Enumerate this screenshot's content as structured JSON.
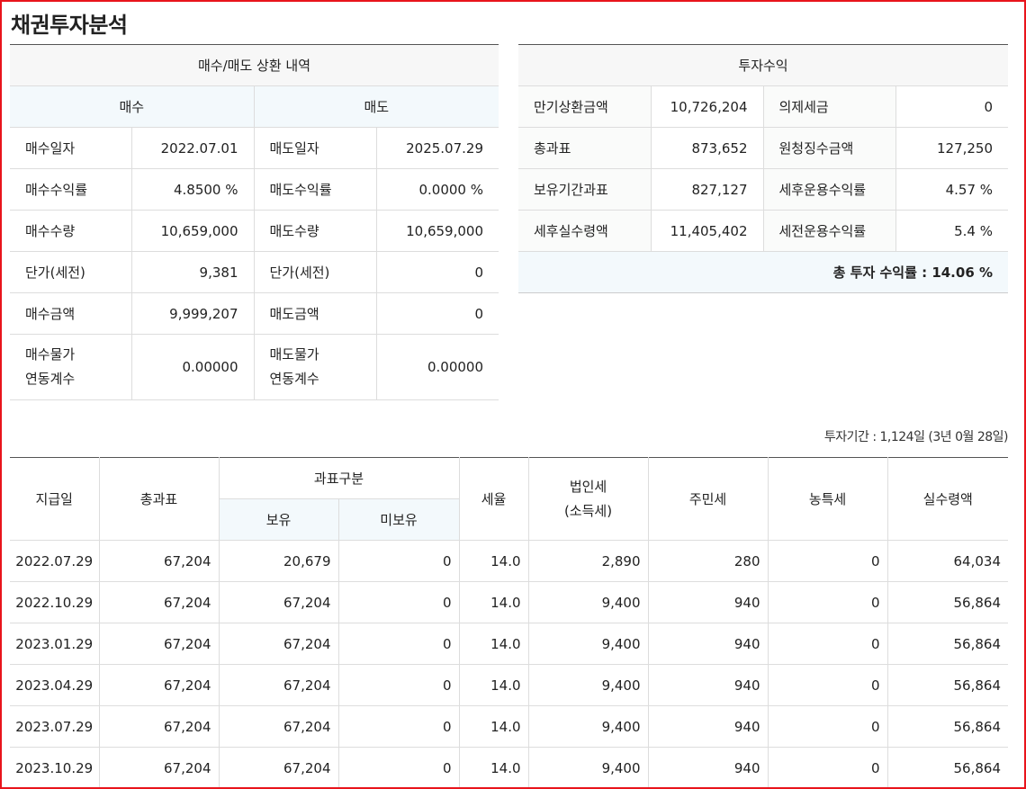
{
  "page_title": "채권투자분석",
  "trade": {
    "title": "매수/매도 상환 내역",
    "buy_header": "매수",
    "sell_header": "매도",
    "rows": [
      {
        "buy_label": "매수일자",
        "buy_value": "2022.07.01",
        "sell_label": "매도일자",
        "sell_value": "2025.07.29"
      },
      {
        "buy_label": "매수수익률",
        "buy_value": "4.8500 %",
        "sell_label": "매도수익률",
        "sell_value": "0.0000 %"
      },
      {
        "buy_label": "매수수량",
        "buy_value": "10,659,000",
        "sell_label": "매도수량",
        "sell_value": "10,659,000"
      },
      {
        "buy_label": "단가(세전)",
        "buy_value": "9,381",
        "sell_label": "단가(세전)",
        "sell_value": "0"
      },
      {
        "buy_label": "매수금액",
        "buy_value": "9,999,207",
        "sell_label": "매도금액",
        "sell_value": "0"
      }
    ],
    "index_row": {
      "buy_label_1": "매수물가",
      "buy_label_2": "연동계수",
      "buy_value": "0.00000",
      "sell_label_1": "매도물가",
      "sell_label_2": "연동계수",
      "sell_value": "0.00000"
    }
  },
  "profit": {
    "title": "투자수익",
    "rows": [
      {
        "l1": "만기상환금액",
        "v1": "10,726,204",
        "l2": "의제세금",
        "v2": "0"
      },
      {
        "l1": "총과표",
        "v1": "873,652",
        "l2": "원청징수금액",
        "v2": "127,250"
      },
      {
        "l1": "보유기간과표",
        "v1": "827,127",
        "l2": "세후운용수익률",
        "v2": "4.57 %"
      },
      {
        "l1": "세후실수령액",
        "v1": "11,405,402",
        "l2": "세전운용수익률",
        "v2": "5.4 %"
      }
    ],
    "total": "총 투자 수익률 : 14.06 %"
  },
  "period_text": "투자기간 : 1,124일 (3년 0월 28일)",
  "payments": {
    "headers": {
      "date": "지급일",
      "total_tax_base": "총과표",
      "tax_base_group": "과표구분",
      "held": "보유",
      "not_held": "미보유",
      "tax_rate": "세율",
      "corp_tax_1": "법인세",
      "corp_tax_2": "(소득세)",
      "resident_tax": "주민세",
      "farm_tax": "농특세",
      "net_amount": "실수령액"
    },
    "rows": [
      [
        "2022.07.29",
        "67,204",
        "20,679",
        "0",
        "14.0",
        "2,890",
        "280",
        "0",
        "64,034"
      ],
      [
        "2022.10.29",
        "67,204",
        "67,204",
        "0",
        "14.0",
        "9,400",
        "940",
        "0",
        "56,864"
      ],
      [
        "2023.01.29",
        "67,204",
        "67,204",
        "0",
        "14.0",
        "9,400",
        "940",
        "0",
        "56,864"
      ],
      [
        "2023.04.29",
        "67,204",
        "67,204",
        "0",
        "14.0",
        "9,400",
        "940",
        "0",
        "56,864"
      ],
      [
        "2023.07.29",
        "67,204",
        "67,204",
        "0",
        "14.0",
        "9,400",
        "940",
        "0",
        "56,864"
      ],
      [
        "2023.10.29",
        "67,204",
        "67,204",
        "0",
        "14.0",
        "9,400",
        "940",
        "0",
        "56,864"
      ]
    ]
  }
}
